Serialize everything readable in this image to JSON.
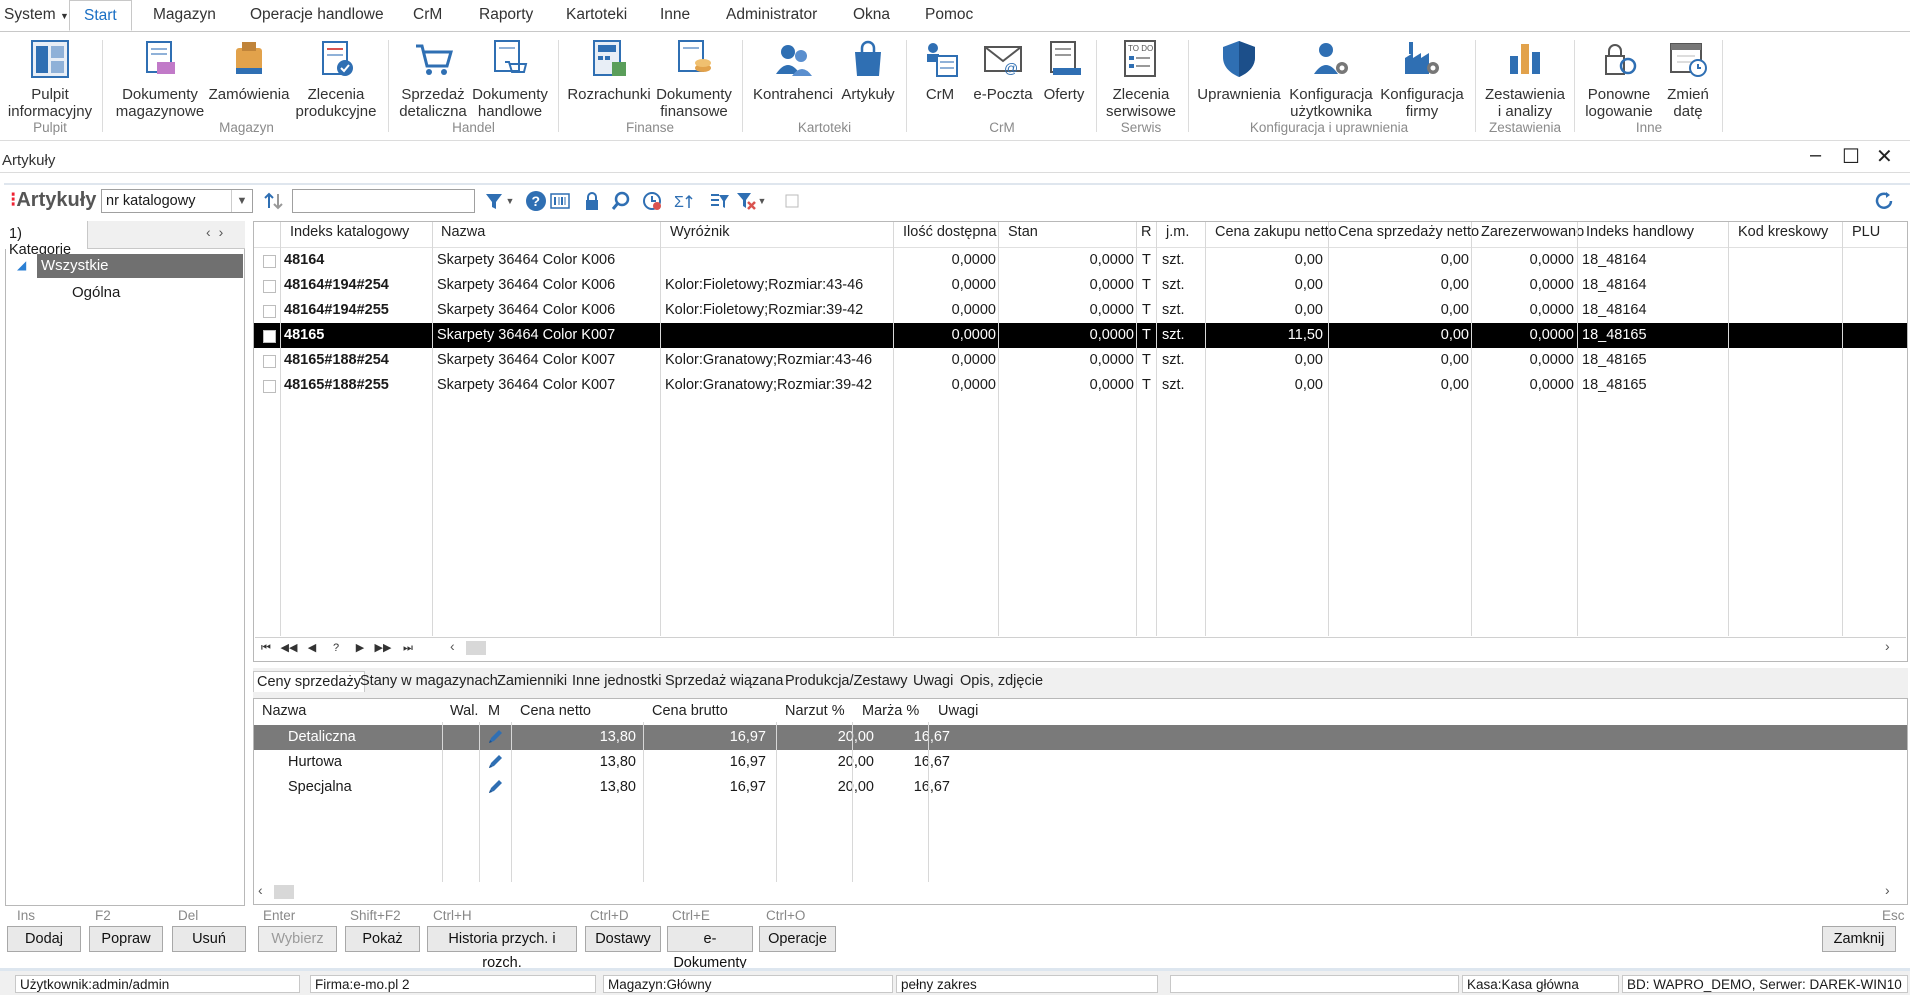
{
  "menu": {
    "system": "System",
    "items": [
      "Start",
      "Magazyn",
      "Operacje handlowe",
      "CrM",
      "Raporty",
      "Kartoteki",
      "Inne",
      "Administrator",
      "Okna",
      "Pomoc"
    ]
  },
  "ribbon": {
    "buttons": [
      {
        "l1": "Pulpit",
        "l2": "informacyjny",
        "icon": "dashboard-icon"
      },
      {
        "l1": "Dokumenty",
        "l2": "magazynowe",
        "icon": "warehouse-docs-icon"
      },
      {
        "l1": "Zamówienia",
        "l2": "",
        "icon": "orders-icon"
      },
      {
        "l1": "Zlecenia",
        "l2": "produkcyjne",
        "icon": "production-orders-icon"
      },
      {
        "l1": "Sprzedaż",
        "l2": "detaliczna",
        "icon": "cart-icon"
      },
      {
        "l1": "Dokumenty",
        "l2": "handlowe",
        "icon": "trade-docs-icon"
      },
      {
        "l1": "Rozrachunki",
        "l2": "",
        "icon": "settlements-icon"
      },
      {
        "l1": "Dokumenty",
        "l2": "finansowe",
        "icon": "finance-docs-icon"
      },
      {
        "l1": "Kontrahenci",
        "l2": "",
        "icon": "contractors-icon"
      },
      {
        "l1": "Artykuły",
        "l2": "",
        "icon": "shopping-bag-icon"
      },
      {
        "l1": "CrM",
        "l2": "",
        "icon": "crm-icon"
      },
      {
        "l1": "e-Poczta",
        "l2": "",
        "icon": "email-icon"
      },
      {
        "l1": "Oferty",
        "l2": "",
        "icon": "offers-icon"
      },
      {
        "l1": "Zlecenia",
        "l2": "serwisowe",
        "icon": "service-orders-icon"
      },
      {
        "l1": "Uprawnienia",
        "l2": "",
        "icon": "shield-icon"
      },
      {
        "l1": "Konfiguracja",
        "l2": "użytkownika",
        "icon": "user-config-icon"
      },
      {
        "l1": "Konfiguracja",
        "l2": "firmy",
        "icon": "company-config-icon"
      },
      {
        "l1": "Zestawienia",
        "l2": "i analizy",
        "icon": "bar-chart-icon"
      },
      {
        "l1": "Ponowne",
        "l2": "logowanie",
        "icon": "relogin-icon"
      },
      {
        "l1": "Zmień",
        "l2": "datę",
        "icon": "calendar-icon"
      }
    ],
    "groups": [
      "Pulpit",
      "Magazyn",
      "Handel",
      "Finanse",
      "Kartoteki",
      "CrM",
      "Serwis",
      "Konfiguracja i uprawnienia",
      "Zestawienia",
      "Inne"
    ]
  },
  "doc_tab": "Artykuły",
  "toolbar": {
    "title": "Artykuły",
    "sort_value": "nr katalogowy",
    "search_value": ""
  },
  "categories": {
    "tab": "1) Kategorie",
    "tree": [
      "Wszystkie",
      "Ogólna"
    ]
  },
  "grid": {
    "headers": [
      "Indeks katalogowy",
      "Nazwa",
      "Wyróżnik",
      "Ilość dostępna",
      "Stan",
      "R",
      "j.m.",
      "Cena zakupu netto",
      "Cena sprzedaży netto",
      "Zarezerwowano",
      "Indeks handlowy",
      "Kod kreskowy",
      "PLU"
    ],
    "rows": [
      {
        "idx": "48164",
        "name": "Skarpety 36464 Color K006",
        "wyr": "",
        "ilosc": "0,0000",
        "stan": "0,0000",
        "r": "T",
        "jm": "szt.",
        "zakup": "0,00",
        "sprzedaz": "0,00",
        "zarez": "0,0000",
        "handl": "18_48164",
        "kod": "",
        "plu": ""
      },
      {
        "idx": "48164#194#254",
        "name": "Skarpety 36464 Color K006",
        "wyr": "Kolor:Fioletowy;Rozmiar:43-46",
        "ilosc": "0,0000",
        "stan": "0,0000",
        "r": "T",
        "jm": "szt.",
        "zakup": "0,00",
        "sprzedaz": "0,00",
        "zarez": "0,0000",
        "handl": "18_48164",
        "kod": "",
        "plu": ""
      },
      {
        "idx": "48164#194#255",
        "name": "Skarpety 36464 Color K006",
        "wyr": "Kolor:Fioletowy;Rozmiar:39-42",
        "ilosc": "0,0000",
        "stan": "0,0000",
        "r": "T",
        "jm": "szt.",
        "zakup": "0,00",
        "sprzedaz": "0,00",
        "zarez": "0,0000",
        "handl": "18_48164",
        "kod": "",
        "plu": ""
      },
      {
        "idx": "48165",
        "name": "Skarpety 36464 Color K007",
        "wyr": "",
        "ilosc": "0,0000",
        "stan": "0,0000",
        "r": "T",
        "jm": "szt.",
        "zakup": "11,50",
        "sprzedaz": "0,00",
        "zarez": "0,0000",
        "handl": "18_48165",
        "kod": "",
        "plu": ""
      },
      {
        "idx": "48165#188#254",
        "name": "Skarpety 36464 Color K007",
        "wyr": "Kolor:Granatowy;Rozmiar:43-46",
        "ilosc": "0,0000",
        "stan": "0,0000",
        "r": "T",
        "jm": "szt.",
        "zakup": "0,00",
        "sprzedaz": "0,00",
        "zarez": "0,0000",
        "handl": "18_48165",
        "kod": "",
        "plu": ""
      },
      {
        "idx": "48165#188#255",
        "name": "Skarpety 36464 Color K007",
        "wyr": "Kolor:Granatowy;Rozmiar:39-42",
        "ilosc": "0,0000",
        "stan": "0,0000",
        "r": "T",
        "jm": "szt.",
        "zakup": "0,00",
        "sprzedaz": "0,00",
        "zarez": "0,0000",
        "handl": "18_48165",
        "kod": "",
        "plu": ""
      }
    ],
    "selected_row": 3,
    "nav": [
      "⏮",
      "◀◀",
      "◀",
      "?",
      "▶",
      "▶▶",
      "⏭"
    ]
  },
  "bottom_tabs": [
    "Ceny sprzedaży",
    "Stany w magazynach",
    "Zamienniki",
    "Inne jednostki",
    "Sprzedaż wiązana",
    "Produkcja/Zestawy",
    "Uwagi",
    "Opis, zdjęcie"
  ],
  "prices": {
    "headers": [
      "Nazwa",
      "Wal.",
      "M",
      "Cena netto",
      "Cena brutto",
      "Narzut %",
      "Marża %",
      "Uwagi"
    ],
    "rows": [
      {
        "name": "Detaliczna",
        "netto": "13,80",
        "brutto": "16,97",
        "narzut": "20,00",
        "marza": "16,67"
      },
      {
        "name": "Hurtowa",
        "netto": "13,80",
        "brutto": "16,97",
        "narzut": "20,00",
        "marza": "16,67"
      },
      {
        "name": "Specjalna",
        "netto": "13,80",
        "brutto": "16,97",
        "narzut": "20,00",
        "marza": "16,67"
      }
    ]
  },
  "buttons": [
    {
      "key": "Ins",
      "label": "Dodaj"
    },
    {
      "key": "F2",
      "label": "Popraw"
    },
    {
      "key": "Del",
      "label": "Usuń"
    },
    {
      "key": "Enter",
      "label": "Wybierz"
    },
    {
      "key": "Shift+F2",
      "label": "Pokaż"
    },
    {
      "key": "Ctrl+H",
      "label": "Historia przych. i rozch."
    },
    {
      "key": "Ctrl+D",
      "label": "Dostawy"
    },
    {
      "key": "Ctrl+E",
      "label": "e-Dokumenty"
    },
    {
      "key": "Ctrl+O",
      "label": "Operacje"
    },
    {
      "key": "Esc",
      "label": "Zamknij"
    }
  ],
  "status": [
    "Użytkownik:admin/admin",
    "Firma:e-mo.pl 2",
    "Magazyn:Główny",
    "pełny zakres",
    "",
    "Kasa:Kasa główna",
    "BD: WAPRO_DEMO, Serwer: DAREK-WIN10"
  ],
  "colors": {
    "accent": "#1a6fc4",
    "icon_blue": "#2f6fb3",
    "icon_orange": "#e2a24b",
    "selected_row": "#000000"
  }
}
